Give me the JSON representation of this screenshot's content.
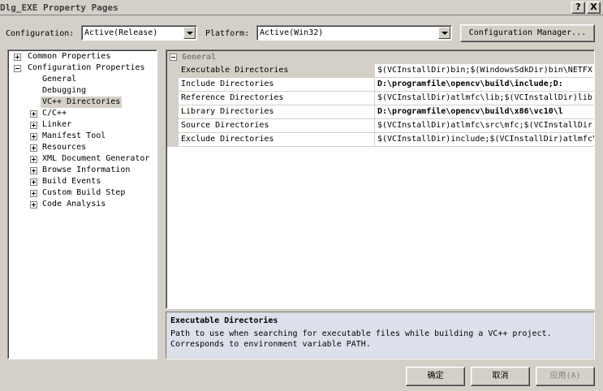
{
  "window": {
    "title": "Dlg_EXE Property Pages",
    "help_label": "?",
    "close_label": "X"
  },
  "config": {
    "configuration_label": "Configuration:",
    "configuration_value": "Active(Release)",
    "platform_label": "Platform:",
    "platform_value": "Active(Win32)",
    "manager_label": "Configuration Manager..."
  },
  "tree": {
    "items": [
      {
        "label": "Common Properties"
      },
      {
        "label": "Configuration Properties"
      },
      {
        "label": "General"
      },
      {
        "label": "Debugging"
      },
      {
        "label": "VC++ Directories"
      },
      {
        "label": "C/C++"
      },
      {
        "label": "Linker"
      },
      {
        "label": "Manifest Tool"
      },
      {
        "label": "Resources"
      },
      {
        "label": "XML Document Generator"
      },
      {
        "label": "Browse Information"
      },
      {
        "label": "Build Events"
      },
      {
        "label": "Custom Build Step"
      },
      {
        "label": "Code Analysis"
      }
    ]
  },
  "grid": {
    "category": "General",
    "rows": [
      {
        "name": "Executable Directories",
        "value": "$(VCInstallDir)bin;$(WindowsSdkDir)bin\\NETFX"
      },
      {
        "name": "Include Directories",
        "value": "D:\\programfile\\opencv\\build\\include;D:"
      },
      {
        "name": "Reference Directories",
        "value": "$(VCInstallDir)atlmfc\\lib;$(VCInstallDir)lib"
      },
      {
        "name": "Library Directories",
        "value": "D:\\programfile\\opencv\\build\\x86\\vc10\\l"
      },
      {
        "name": "Source Directories",
        "value": "$(VCInstallDir)atlmfc\\src\\mfc;$(VCInstallDir)"
      },
      {
        "name": "Exclude Directories",
        "value": "$(VCInstallDir)include;$(VCInstallDir)atlmfc\\"
      }
    ]
  },
  "description": {
    "title": "Executable Directories",
    "text": "Path to use when searching for executable files while building a VC++ project.\nCorresponds to environment variable PATH."
  },
  "buttons": {
    "ok": "确定",
    "cancel": "取消",
    "apply": "应用(A)"
  },
  "colors": {
    "face": "#d4d0c8",
    "disabled_text": "#808080"
  }
}
